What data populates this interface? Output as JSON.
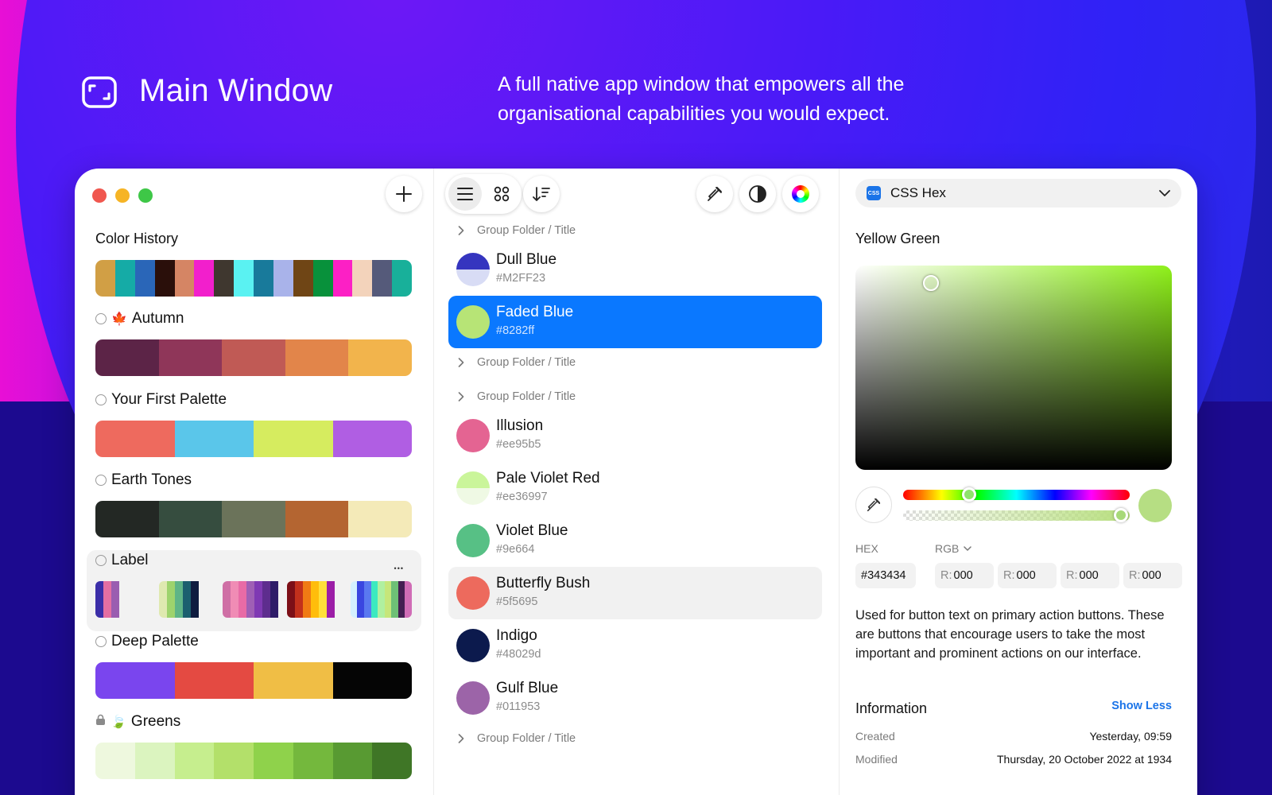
{
  "hero": {
    "title": "Main Window",
    "description": "A full native app window that empowers all the organisational capabilities you would expect."
  },
  "toolbar": {
    "add_icon": "plus-icon",
    "view_list_icon": "list-icon",
    "view_grid_icon": "grid-icon",
    "sort_icon": "sort-icon",
    "picker_icon": "eyedropper-icon",
    "contrast_icon": "contrast-icon",
    "wheel_icon": "color-wheel-icon"
  },
  "sidebar": {
    "history_title": "Color History",
    "history_colors": [
      "#d19f45",
      "#15aba6",
      "#2a66b8",
      "#2a0f0a",
      "#d58564",
      "#f21fcc",
      "#3f372f",
      "#5af2f2",
      "#187a9b",
      "#a9b3ea",
      "#6f4515",
      "#08913b",
      "#fc20c5",
      "#f3d3bb",
      "#555a7a",
      "#18b09a"
    ],
    "palettes": [
      {
        "name": "Autumn",
        "emoji": "🍁",
        "colors": [
          "#5c2447",
          "#8f3659",
          "#c05a55",
          "#e2854a",
          "#f2b44c"
        ]
      },
      {
        "name": "Your First Palette",
        "emoji": "",
        "colors": [
          "#ee6a5e",
          "#5ac6ea",
          "#d6ec5f",
          "#b05ee3"
        ]
      },
      {
        "name": "Earth Tones",
        "emoji": "",
        "colors": [
          "#232824",
          "#364d3f",
          "#6b735a",
          "#b46531",
          "#f4eab8"
        ]
      },
      {
        "name": "Label",
        "emoji": "",
        "groups": [
          [
            "#3b2ea8",
            "#e46ea2",
            "#9a5db0"
          ],
          [
            "#dfe9b0",
            "#9ed36d",
            "#5fb487",
            "#1b5f6f",
            "#0f1c40"
          ],
          [
            "#cf6fa5",
            "#f08cb5",
            "#e86ba6",
            "#9f5fb5",
            "#7f39b3",
            "#5e2d8e",
            "#2e1c68"
          ],
          [
            "#7c0f17",
            "#c2301c",
            "#f07a14",
            "#ffbd0b",
            "#ffe03a",
            "#9c1ea7"
          ],
          [
            "#d4f0ff",
            "#3a46e0",
            "#5a78f0",
            "#3ce9c0",
            "#b0f0a0",
            "#c6e67a",
            "#6ec076",
            "#441e52",
            "#d06cb6"
          ]
        ]
      },
      {
        "name": "Deep Palette",
        "emoji": "",
        "colors": [
          "#7a45ee",
          "#e44a42",
          "#f0be45",
          "#050505"
        ]
      },
      {
        "name": "Greens",
        "emoji": "🍃",
        "locked": true,
        "colors": [
          "#eef8de",
          "#dbf4bf",
          "#c6ee8e",
          "#b3e06a",
          "#8fd24b",
          "#74b83d",
          "#589a32",
          "#3f7626"
        ]
      }
    ]
  },
  "list": {
    "rows": [
      {
        "type": "group",
        "label": "Group Folder / Title"
      },
      {
        "type": "color",
        "name": "Dull Blue",
        "hex": "#M2FF23",
        "swatch_top": "#3535bf",
        "swatch_bottom": "#d8dcf5"
      },
      {
        "type": "color",
        "name": "Faded Blue",
        "hex": "#8282ff",
        "swatch_top": "#b7e476",
        "swatch_bottom": "#b7e476",
        "state": "selected"
      },
      {
        "type": "group",
        "label": "Group Folder / Title"
      },
      {
        "type": "group",
        "label": "Group Folder / Title"
      },
      {
        "type": "color",
        "name": "Illusion",
        "hex": "#ee95b5",
        "swatch_top": "#e46492",
        "swatch_bottom": "#e46492"
      },
      {
        "type": "color",
        "name": "Pale Violet Red",
        "hex": "#ee36997",
        "swatch_top": "#caf59a",
        "swatch_bottom": "#eff9e4"
      },
      {
        "type": "color",
        "name": "Violet Blue",
        "hex": "#9e664",
        "swatch_top": "#57c085",
        "swatch_bottom": "#57c085"
      },
      {
        "type": "color",
        "name": "Butterfly Bush",
        "hex": "#5f5695",
        "swatch_top": "#ed6a5d",
        "swatch_bottom": "#ed6a5d",
        "state": "hover"
      },
      {
        "type": "color",
        "name": "Indigo",
        "hex": "#48029d",
        "swatch_top": "#0c1a4d",
        "swatch_bottom": "#0c1a4d"
      },
      {
        "type": "color",
        "name": "Gulf Blue",
        "hex": "#011953",
        "swatch_top": "#9c64a8",
        "swatch_bottom": "#9c64a8"
      },
      {
        "type": "group",
        "label": "Group Folder / Title"
      }
    ]
  },
  "detail": {
    "format": "CSS Hex",
    "format_badge": "CSS",
    "color_name": "Yellow Green",
    "hue": 0.29,
    "alpha": 0.96,
    "preview_color": "#b6de83",
    "hex_label": "HEX",
    "mode_label": "RGB",
    "hex_value": "#343434",
    "rgb_fields": [
      {
        "prefix": "R:",
        "value": "000"
      },
      {
        "prefix": "R:",
        "value": "000"
      },
      {
        "prefix": "R:",
        "value": "000"
      },
      {
        "prefix": "R:",
        "value": "000"
      }
    ],
    "description": "Used for button text on primary action buttons. These are buttons that encourage users to take the most important and prominent actions on our interface.",
    "info_title": "Information",
    "show_less": "Show Less",
    "created_label": "Created",
    "created_value": "Yesterday, 09:59",
    "modified_label": "Modified",
    "modified_value": "Thursday, 20 October 2022 at 1934"
  }
}
